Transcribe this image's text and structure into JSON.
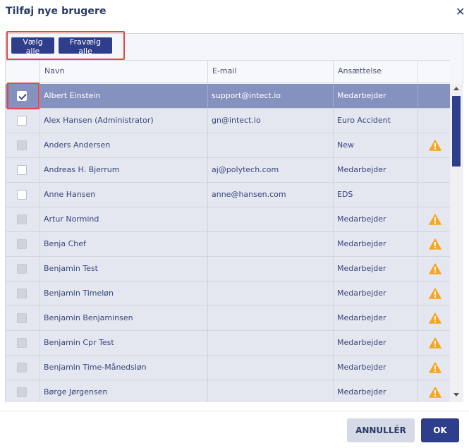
{
  "dialog": {
    "title": "Tilføj nye brugere",
    "close_icon": "close-icon"
  },
  "toolbar": {
    "select_all_label": "Vælg alle",
    "deselect_all_label": "Fravælg alle"
  },
  "table": {
    "columns": [
      "",
      "Navn",
      "E-mail",
      "Ansættelse",
      ""
    ],
    "rows": [
      {
        "name": "Albert Einstein",
        "email": "support@intect.io",
        "employment": "Medarbejder",
        "checkbox": "checked",
        "selected": true,
        "warning": false
      },
      {
        "name": "Alex Hansen (Administrator)",
        "email": "gn@intect.io",
        "employment": "Euro Accident",
        "checkbox": "enabled",
        "selected": false,
        "warning": false
      },
      {
        "name": "Anders Andersen",
        "email": "",
        "employment": "New",
        "checkbox": "disabled",
        "selected": false,
        "warning": true
      },
      {
        "name": "Andreas H. Bjerrum",
        "email": "aj@polytech.com",
        "employment": "Medarbejder",
        "checkbox": "enabled",
        "selected": false,
        "warning": false
      },
      {
        "name": "Anne Hansen",
        "email": "anne@hansen.com",
        "employment": "EDS",
        "checkbox": "enabled",
        "selected": false,
        "warning": false
      },
      {
        "name": "Artur Normind",
        "email": "",
        "employment": "Medarbejder",
        "checkbox": "disabled",
        "selected": false,
        "warning": true
      },
      {
        "name": "Benja Chef",
        "email": "",
        "employment": "Medarbejder",
        "checkbox": "disabled",
        "selected": false,
        "warning": true
      },
      {
        "name": "Benjamin Test",
        "email": "",
        "employment": "Medarbejder",
        "checkbox": "disabled",
        "selected": false,
        "warning": true
      },
      {
        "name": "Benjamin Timeløn",
        "email": "",
        "employment": "Medarbejder",
        "checkbox": "disabled",
        "selected": false,
        "warning": true
      },
      {
        "name": "Benjamin Benjaminsen",
        "email": "",
        "employment": "Medarbejder",
        "checkbox": "disabled",
        "selected": false,
        "warning": true
      },
      {
        "name": "Benjamin Cpr Test",
        "email": "",
        "employment": "Medarbejder",
        "checkbox": "disabled",
        "selected": false,
        "warning": true
      },
      {
        "name": "Benjamin Time-Månedsløn",
        "email": "",
        "employment": "Medarbejder",
        "checkbox": "disabled",
        "selected": false,
        "warning": true
      },
      {
        "name": "Børge Jørgensen",
        "email": "",
        "employment": "Medarbejder",
        "checkbox": "disabled",
        "selected": false,
        "warning": true
      }
    ],
    "warning_icon": "warning-icon",
    "warning_color": "#f5a623"
  },
  "footer": {
    "cancel_label": "ANNULLÉR",
    "ok_label": "OK"
  },
  "colors": {
    "primary": "#2e3e8a",
    "selected_row": "#8592bf",
    "row_bg": "#e4e7ef",
    "highlight_box": "#e04848"
  }
}
